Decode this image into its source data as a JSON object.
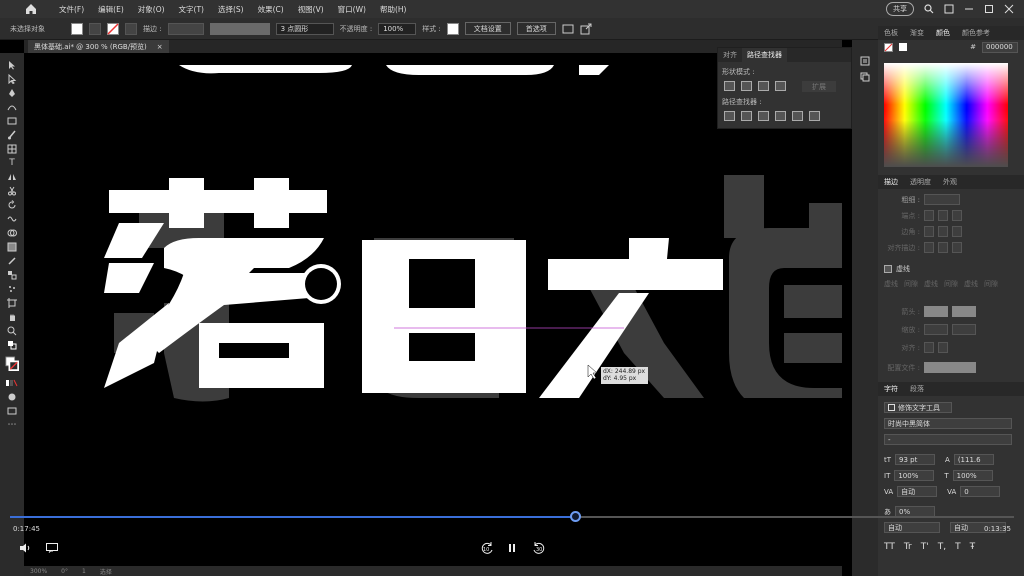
{
  "menubar": {
    "items": [
      "文件(F)",
      "编辑(E)",
      "对象(O)",
      "文字(T)",
      "选择(S)",
      "效果(C)",
      "视图(V)",
      "窗口(W)",
      "帮助(H)"
    ],
    "share_label": "共享"
  },
  "controlbar": {
    "no_selection": "未选择对象",
    "stroke_label": "描边 :",
    "brush_value": "3 点圆形",
    "opacity_label": "不透明度 :",
    "opacity_value": "100%",
    "style_label": "样式 :",
    "doc_settings_label": "文档设置",
    "preferences_label": "首选项"
  },
  "document": {
    "tab_title": "黑体基础.ai* @ 300 % (RGB/预览)",
    "close_glyph": "×"
  },
  "canvas": {
    "chars": [
      "落",
      "日",
      "大",
      "道"
    ],
    "readout_dx": "dX: 244.89 px",
    "readout_dy": "dY: 4.95 px"
  },
  "pathfinder": {
    "tab_align": "对齐",
    "tab_pathfinder": "路径查找器",
    "shape_modes_label": "形状模式 :",
    "pathfinders_label": "路径查找器 :",
    "apply_label": "扩展"
  },
  "color_panel": {
    "tabs": [
      "色板",
      "渐变",
      "颜色",
      "颜色参考"
    ],
    "active_tab": "颜色",
    "hex_prefix": "#",
    "hex_value": "000000"
  },
  "stroke_panel": {
    "tabs": [
      "描边",
      "透明度",
      "外观"
    ],
    "weight_label": "粗细 :",
    "cap_label": "端点 :",
    "corner_label": "边角 :",
    "align_label": "对齐描边 :",
    "dashed_label": "虚线",
    "dash_labels": [
      "虚线",
      "间隙",
      "虚线",
      "间隙",
      "虚线",
      "间隙"
    ],
    "arrowhead_label": "箭头 :",
    "scale_label": "缩放 :",
    "align2_label": "对齐 :",
    "profile_label": "配置文件 :"
  },
  "char_panel": {
    "tabs": [
      "字符",
      "段落"
    ],
    "touch_type_label": "修饰文字工具",
    "font_name": "时尚中黑简体",
    "font_style": "-",
    "size_value": "93 pt",
    "leading_value": "(111.6",
    "hscale_value": "100%",
    "vscale_value": "100%",
    "kerning_value": "自动",
    "tracking_value": "0",
    "tsume_value": "0%",
    "aki_left": "自动",
    "aki_right": "自动"
  },
  "video": {
    "progress": 0.563,
    "current_time": "0:17:45",
    "total_time": "0:13:35",
    "rewind_label": "10",
    "forward_label": "30"
  },
  "statusbar": {
    "zoom": "300%",
    "rotation": "0°",
    "artboard": "1",
    "tool": "选择"
  },
  "colors": {
    "accent": "#3a6ed8",
    "panel_bg": "#323232",
    "canvas_bg": "#000000",
    "guide": "#c04bd0"
  }
}
